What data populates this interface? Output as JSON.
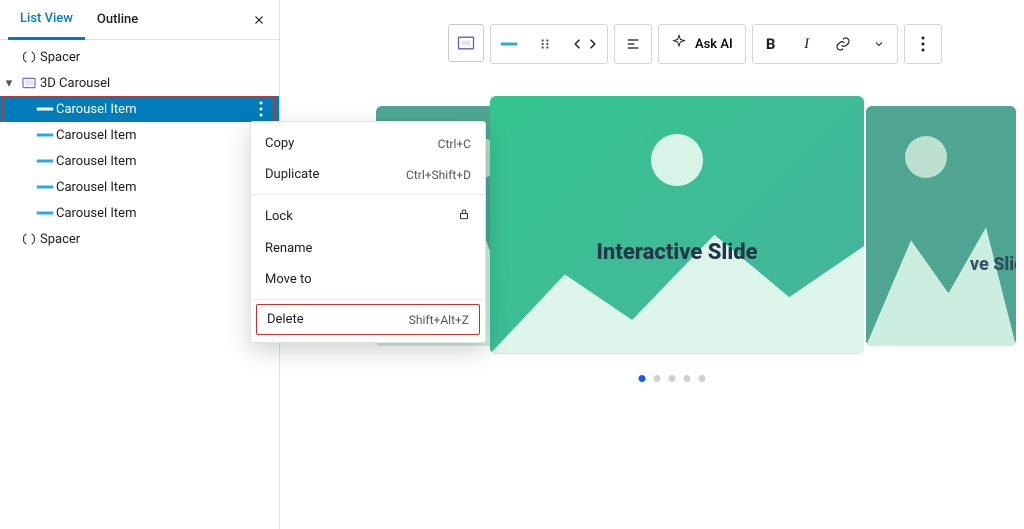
{
  "sidebar": {
    "tabs": {
      "list_view": "List View",
      "outline": "Outline"
    },
    "tree": {
      "spacer1": "Spacer",
      "carousel_parent": "3D Carousel",
      "items": [
        {
          "label": "Carousel Item"
        },
        {
          "label": "Carousel Item"
        },
        {
          "label": "Carousel Item"
        },
        {
          "label": "Carousel Item"
        },
        {
          "label": "Carousel Item"
        }
      ],
      "spacer2": "Spacer"
    }
  },
  "context_menu": {
    "copy": {
      "label": "Copy",
      "shortcut": "Ctrl+C"
    },
    "duplicate": {
      "label": "Duplicate",
      "shortcut": "Ctrl+Shift+D"
    },
    "lock": {
      "label": "Lock"
    },
    "rename": {
      "label": "Rename"
    },
    "move_to": {
      "label": "Move to"
    },
    "delete": {
      "label": "Delete",
      "shortcut": "Shift+Alt+Z"
    }
  },
  "toolbar": {
    "ask_ai": "Ask AI"
  },
  "slides": {
    "main_title": "Interactive Slide",
    "right_title": "ve Slide"
  },
  "pager": {
    "count": 5,
    "active": 0
  },
  "colors": {
    "primary": "#007cba",
    "highlight": "#c1362f"
  }
}
